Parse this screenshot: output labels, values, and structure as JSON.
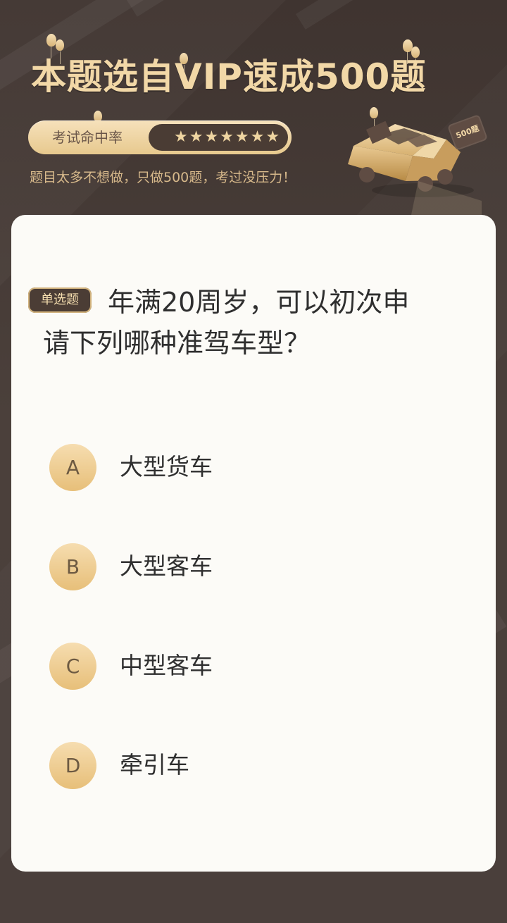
{
  "header": {
    "title": "本题选自VIP速成500题",
    "rating_label": "考试命中率",
    "rating_stars": "★★★★★★★",
    "subtitle": "题目太多不想做，只做500题，考过没压力！",
    "badge_text": "500题",
    "colors": {
      "title": "#f2d8a7",
      "accent": "#e7c98e"
    }
  },
  "question": {
    "type_label": "单选题",
    "line1": "年满20周岁，可以初次申",
    "line2": "请下列哪种准驾车型？",
    "options": [
      {
        "letter": "A",
        "text": "大型货车"
      },
      {
        "letter": "B",
        "text": "大型客车"
      },
      {
        "letter": "C",
        "text": "中型客车"
      },
      {
        "letter": "D",
        "text": "牵引车"
      }
    ]
  },
  "icons": {
    "stars": "star-icon",
    "car": "car-icon",
    "balloon": "balloon-icon"
  }
}
